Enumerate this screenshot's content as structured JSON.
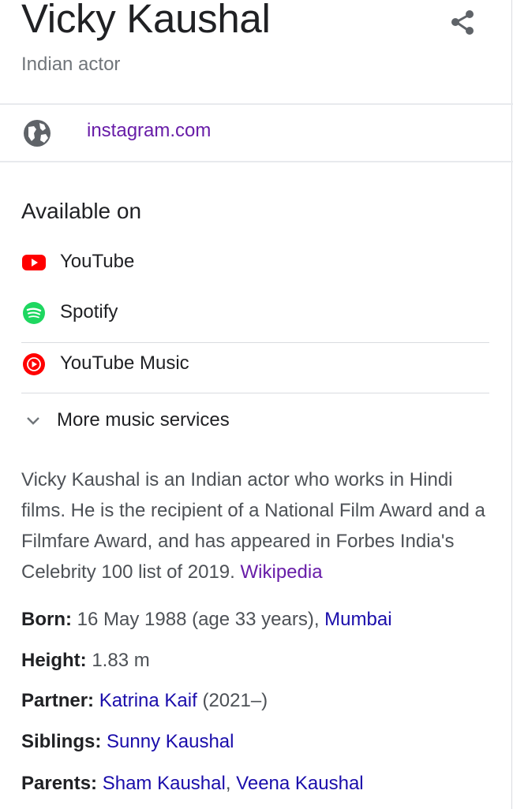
{
  "header": {
    "title": "Vicky Kaushal",
    "subtitle": "Indian actor",
    "share_icon": "share-icon"
  },
  "website": {
    "icon": "globe-icon",
    "label": "instagram.com",
    "color": "#681da8"
  },
  "available_on": {
    "heading": "Available on",
    "services": [
      {
        "label": "YouTube",
        "icon": "youtube-icon",
        "color": "#ff0000"
      },
      {
        "label": "Spotify",
        "icon": "spotify-icon",
        "color": "#1ed760"
      },
      {
        "label": "YouTube Music",
        "icon": "youtube-music-icon",
        "color": "#ff0000"
      }
    ],
    "more_label": "More music services"
  },
  "description": {
    "text": "Vicky Kaushal is an Indian actor who works in Hindi films. He is the recipient of a National Film Award and a Filmfare Award, and has appeared in Forbes India's Celebrity 100 list of 2019.",
    "source_link": "Wikipedia"
  },
  "facts": {
    "born": {
      "label": "Born:",
      "text": "16 May 1988 (age 33 years),",
      "link": "Mumbai"
    },
    "height": {
      "label": "Height:",
      "text": "1.83 m"
    },
    "partner": {
      "label": "Partner:",
      "link": "Katrina Kaif",
      "text": "(2021–)"
    },
    "siblings": {
      "label": "Siblings:",
      "link": "Sunny Kaushal"
    },
    "parents": {
      "label": "Parents:",
      "link1": "Sham Kaushal",
      "sep": ",",
      "link2": "Veena Kaushal"
    }
  },
  "colors": {
    "link_blue": "#1a0dab",
    "visited_purple": "#681da8",
    "text_dark": "#202124",
    "text_grey": "#4d5156"
  }
}
